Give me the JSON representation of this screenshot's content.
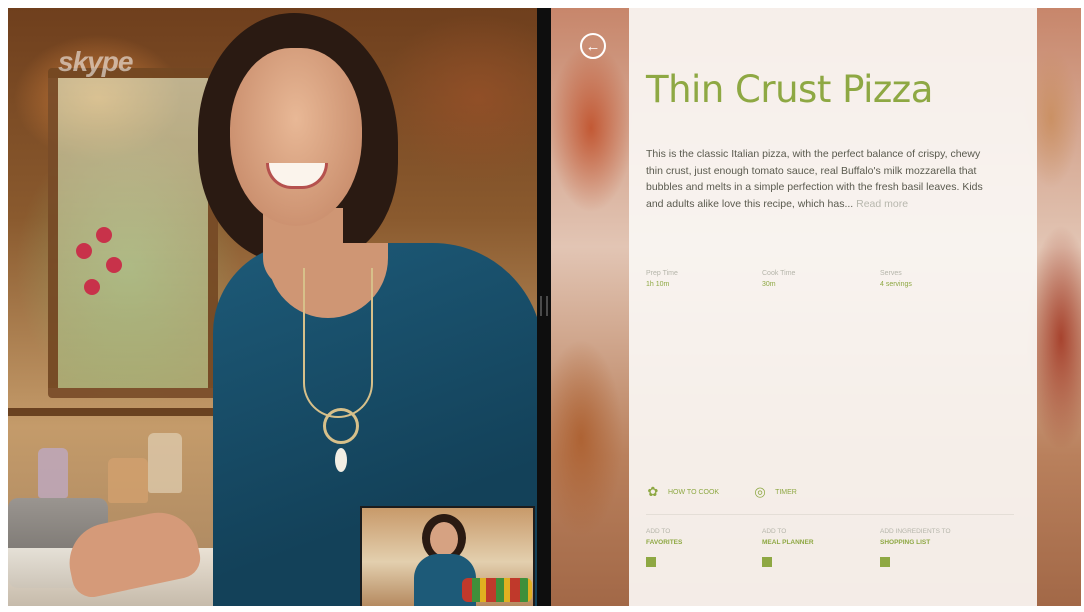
{
  "skype": {
    "logo_text": "skype"
  },
  "recipe": {
    "title": "Thin Crust Pizza",
    "description": "This is the classic Italian pizza, with the perfect balance of crispy, chewy thin crust, just enough tomato sauce, real Buffalo's milk mozzarella that bubbles and melts in a simple perfection with the fresh basil leaves. Kids and adults alike love this recipe, which has...",
    "read_more": "Read more",
    "meta": [
      {
        "label": "Prep Time",
        "value": "1h 10m"
      },
      {
        "label": "Cook Time",
        "value": "30m"
      },
      {
        "label": "Serves",
        "value": "4 servings"
      }
    ],
    "actions": [
      {
        "icon": "chef-hat-icon",
        "label": "HOW TO COOK"
      },
      {
        "icon": "timer-icon",
        "label": "TIMER"
      }
    ],
    "add_to": [
      {
        "label": "ADD TO",
        "value": "FAVORITES"
      },
      {
        "label": "ADD TO",
        "value": "MEAL PLANNER"
      },
      {
        "label": "ADD INGREDIENTS TO",
        "value": "SHOPPING LIST"
      }
    ]
  },
  "colors": {
    "accent": "#8ea843",
    "card": "#faf6f3",
    "splitter": "#0e0e0e"
  }
}
